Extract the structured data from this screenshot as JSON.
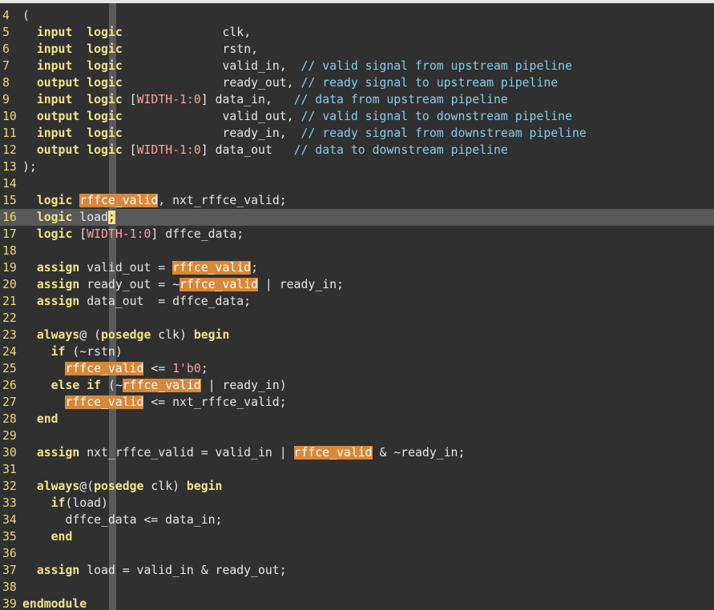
{
  "editor": {
    "colors": {
      "background": "#303030",
      "line_number": "#e6db74",
      "keyword": "#f0e68c",
      "comment": "#87ceeb",
      "constant": "#ff9f9f",
      "search_highlight": "#d7883a",
      "current_line": "#595959",
      "color_column": "#5a5a5a"
    },
    "current_line_number": "16",
    "lines": [
      {
        "n": "4",
        "tokens": [
          [
            "pu",
            "("
          ]
        ]
      },
      {
        "n": "5",
        "tokens": [
          [
            "pu",
            "  "
          ],
          [
            "kw",
            "input"
          ],
          [
            "pu",
            "  "
          ],
          [
            "ty",
            "logic"
          ],
          [
            "pu",
            "              clk,"
          ]
        ]
      },
      {
        "n": "6",
        "tokens": [
          [
            "pu",
            "  "
          ],
          [
            "kw",
            "input"
          ],
          [
            "pu",
            "  "
          ],
          [
            "ty",
            "logic"
          ],
          [
            "pu",
            "              rstn,"
          ]
        ]
      },
      {
        "n": "7",
        "tokens": [
          [
            "pu",
            "  "
          ],
          [
            "kw",
            "input"
          ],
          [
            "pu",
            "  "
          ],
          [
            "ty",
            "logic"
          ],
          [
            "pu",
            "              valid_in,  "
          ],
          [
            "cm",
            "// valid signal from upstream pipeline"
          ]
        ]
      },
      {
        "n": "8",
        "tokens": [
          [
            "pu",
            "  "
          ],
          [
            "kw",
            "output"
          ],
          [
            "pu",
            " "
          ],
          [
            "ty",
            "logic"
          ],
          [
            "pu",
            "              ready_out, "
          ],
          [
            "cm",
            "// ready signal to upstream pipeline"
          ]
        ]
      },
      {
        "n": "9",
        "tokens": [
          [
            "pu",
            "  "
          ],
          [
            "kw",
            "input"
          ],
          [
            "pu",
            "  "
          ],
          [
            "ty",
            "logic"
          ],
          [
            "pu",
            " ["
          ],
          [
            "cn",
            "WIDTH-1:0"
          ],
          [
            "pu",
            "] data_in,   "
          ],
          [
            "cm",
            "// data from upstream pipeline"
          ]
        ]
      },
      {
        "n": "10",
        "tokens": [
          [
            "pu",
            "  "
          ],
          [
            "kw",
            "output"
          ],
          [
            "pu",
            " "
          ],
          [
            "ty",
            "logic"
          ],
          [
            "pu",
            "              valid_out, "
          ],
          [
            "cm",
            "// valid signal to downstream pipeline"
          ]
        ]
      },
      {
        "n": "11",
        "tokens": [
          [
            "pu",
            "  "
          ],
          [
            "kw",
            "input"
          ],
          [
            "pu",
            "  "
          ],
          [
            "ty",
            "logic"
          ],
          [
            "pu",
            "              ready_in,  "
          ],
          [
            "cm",
            "// ready signal from downstream pipeline"
          ]
        ]
      },
      {
        "n": "12",
        "tokens": [
          [
            "pu",
            "  "
          ],
          [
            "kw",
            "output"
          ],
          [
            "pu",
            " "
          ],
          [
            "ty",
            "logic"
          ],
          [
            "pu",
            " ["
          ],
          [
            "cn",
            "WIDTH-1:0"
          ],
          [
            "pu",
            "] data_out   "
          ],
          [
            "cm",
            "// data to downstream pipeline"
          ]
        ]
      },
      {
        "n": "13",
        "tokens": [
          [
            "pu",
            ");"
          ]
        ]
      },
      {
        "n": "14",
        "tokens": []
      },
      {
        "n": "15",
        "tokens": [
          [
            "pu",
            "  "
          ],
          [
            "ty",
            "logic"
          ],
          [
            "pu",
            " "
          ],
          [
            "hl",
            "rffce_valid"
          ],
          [
            "pu",
            ", nxt_rffce_valid;"
          ]
        ]
      },
      {
        "n": "16",
        "tokens": [
          [
            "pu",
            "  "
          ],
          [
            "ty",
            "logic"
          ],
          [
            "pu",
            " load"
          ],
          [
            "cur",
            ";"
          ]
        ]
      },
      {
        "n": "17",
        "tokens": [
          [
            "pu",
            "  "
          ],
          [
            "ty",
            "logic"
          ],
          [
            "pu",
            " ["
          ],
          [
            "cn",
            "WIDTH-1:0"
          ],
          [
            "pu",
            "] dffce_data;"
          ]
        ]
      },
      {
        "n": "18",
        "tokens": []
      },
      {
        "n": "19",
        "tokens": [
          [
            "pu",
            "  "
          ],
          [
            "kw",
            "assign"
          ],
          [
            "pu",
            " valid_out = "
          ],
          [
            "hl",
            "rffce_valid"
          ],
          [
            "pu",
            ";"
          ]
        ]
      },
      {
        "n": "20",
        "tokens": [
          [
            "pu",
            "  "
          ],
          [
            "kw",
            "assign"
          ],
          [
            "pu",
            " ready_out = ~"
          ],
          [
            "hl",
            "rffce_valid"
          ],
          [
            "pu",
            " | ready_in;"
          ]
        ]
      },
      {
        "n": "21",
        "tokens": [
          [
            "pu",
            "  "
          ],
          [
            "kw",
            "assign"
          ],
          [
            "pu",
            " data_out  = dffce_data;"
          ]
        ]
      },
      {
        "n": "22",
        "tokens": []
      },
      {
        "n": "23",
        "tokens": [
          [
            "pu",
            "  "
          ],
          [
            "kw",
            "always"
          ],
          [
            "pu",
            "@ ("
          ],
          [
            "kw",
            "posedge"
          ],
          [
            "pu",
            " clk) "
          ],
          [
            "kw",
            "begin"
          ]
        ]
      },
      {
        "n": "24",
        "tokens": [
          [
            "pu",
            "    "
          ],
          [
            "kw",
            "if"
          ],
          [
            "pu",
            " (~rstn)"
          ]
        ]
      },
      {
        "n": "25",
        "tokens": [
          [
            "pu",
            "      "
          ],
          [
            "hl",
            "rffce_valid"
          ],
          [
            "pu",
            " <= "
          ],
          [
            "cn",
            "1'b0"
          ],
          [
            "pu",
            ";"
          ]
        ]
      },
      {
        "n": "26",
        "tokens": [
          [
            "pu",
            "    "
          ],
          [
            "kw",
            "else"
          ],
          [
            "pu",
            " "
          ],
          [
            "kw",
            "if"
          ],
          [
            "pu",
            " (~"
          ],
          [
            "hl",
            "rffce_valid"
          ],
          [
            "pu",
            " | ready_in)"
          ]
        ]
      },
      {
        "n": "27",
        "tokens": [
          [
            "pu",
            "      "
          ],
          [
            "hl",
            "rffce_valid"
          ],
          [
            "pu",
            " <= nxt_rffce_valid;"
          ]
        ]
      },
      {
        "n": "28",
        "tokens": [
          [
            "pu",
            "  "
          ],
          [
            "kw",
            "end"
          ]
        ]
      },
      {
        "n": "29",
        "tokens": []
      },
      {
        "n": "30",
        "tokens": [
          [
            "pu",
            "  "
          ],
          [
            "kw",
            "assign"
          ],
          [
            "pu",
            " nxt_rffce_valid = valid_in | "
          ],
          [
            "hl",
            "rffce_valid"
          ],
          [
            "pu",
            " & ~ready_in;"
          ]
        ]
      },
      {
        "n": "31",
        "tokens": []
      },
      {
        "n": "32",
        "tokens": [
          [
            "pu",
            "  "
          ],
          [
            "kw",
            "always"
          ],
          [
            "pu",
            "@("
          ],
          [
            "kw",
            "posedge"
          ],
          [
            "pu",
            " clk) "
          ],
          [
            "kw",
            "begin"
          ]
        ]
      },
      {
        "n": "33",
        "tokens": [
          [
            "pu",
            "    "
          ],
          [
            "kw",
            "if"
          ],
          [
            "pu",
            "(load)"
          ]
        ]
      },
      {
        "n": "34",
        "tokens": [
          [
            "pu",
            "      dffce_data <= data_in;"
          ]
        ]
      },
      {
        "n": "35",
        "tokens": [
          [
            "pu",
            "    "
          ],
          [
            "kw",
            "end"
          ]
        ]
      },
      {
        "n": "36",
        "tokens": []
      },
      {
        "n": "37",
        "tokens": [
          [
            "pu",
            "  "
          ],
          [
            "kw",
            "assign"
          ],
          [
            "pu",
            " load = valid_in & ready_out;"
          ]
        ]
      },
      {
        "n": "38",
        "tokens": []
      },
      {
        "n": "39",
        "tokens": [
          [
            "kw",
            "endmodule"
          ]
        ]
      }
    ]
  }
}
